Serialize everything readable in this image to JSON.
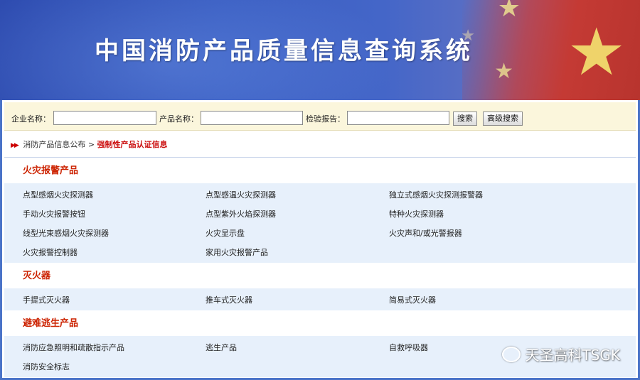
{
  "header": {
    "title": "中国消防产品质量信息查询系统"
  },
  "search": {
    "company_label": "企业名称：",
    "company_value": "",
    "product_label": "产品名称：",
    "product_value": "",
    "report_label": "检验报告：",
    "report_value": "",
    "search_button": "搜索",
    "advanced_button": "高级搜索"
  },
  "breadcrumb": {
    "parent": "消防产品信息公布",
    "separator": ">",
    "current": "强制性产品认证信息"
  },
  "sections": [
    {
      "title": "火灾报警产品",
      "rows": [
        [
          "点型感烟火灾探测器",
          "点型感温火灾探测器",
          "独立式感烟火灾探测报警器"
        ],
        [
          "手动火灾报警按钮",
          "点型紫外火焰探测器",
          "特种火灾探测器"
        ],
        [
          "线型光束感烟火灾探测器",
          "火灾显示盘",
          "火灾声和/或光警报器"
        ],
        [
          "火灾报警控制器",
          "家用火灾报警产品",
          ""
        ]
      ]
    },
    {
      "title": "灭火器",
      "rows": [
        [
          "手提式灭火器",
          "推车式灭火器",
          "简易式灭火器"
        ]
      ]
    },
    {
      "title": "避难逃生产品",
      "rows": [
        [
          "消防应急照明和疏散指示产品",
          "逃生产品",
          "自救呼吸器"
        ],
        [
          "消防安全标志",
          "",
          ""
        ]
      ]
    }
  ],
  "watermark": {
    "text": "天圣高科TSGK",
    "icon": "wechat-icon"
  },
  "colors": {
    "banner_blue": "#3a5ec2",
    "section_title": "#cc2200",
    "row_background": "#e7f0fb",
    "searchbar_background": "#fbf6dc"
  }
}
